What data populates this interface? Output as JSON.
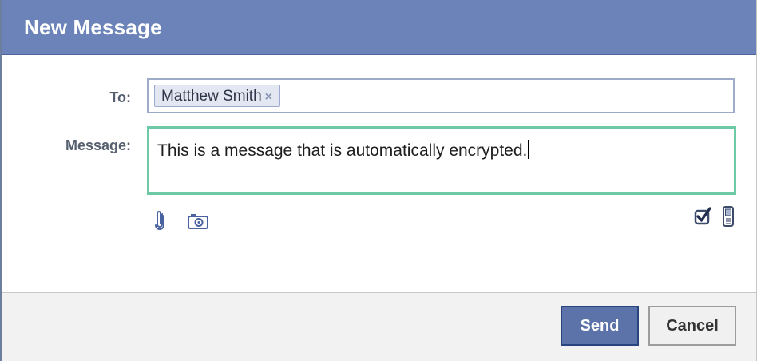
{
  "dialog": {
    "title": "New Message"
  },
  "form": {
    "to_label": "To:",
    "message_label": "Message:",
    "recipients": [
      {
        "name": "Matthew Smith",
        "remove_glyph": "×"
      }
    ],
    "message_text": "This is a message that is automatically encrypted."
  },
  "toolbar": {
    "left_icons": [
      "paperclip-icon",
      "camera-icon"
    ],
    "right_icons": [
      "checkbox-checked-icon",
      "mobile-phone-icon"
    ]
  },
  "buttons": {
    "send_label": "Send",
    "cancel_label": "Cancel"
  },
  "colors": {
    "header": "#6b83b8",
    "focus_border": "#6ec9a7",
    "send_button": "#5b73a8",
    "icon_blue": "#4a62a0"
  }
}
